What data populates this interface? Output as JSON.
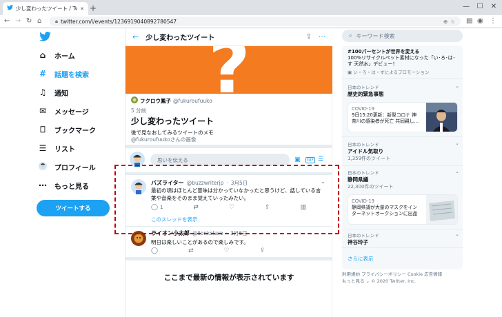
{
  "browser": {
    "tab_title": "少し変わったツイート / Twitter",
    "url": "twitter.com/i/events/1236919040892780547",
    "new_tab": "+",
    "window": {
      "min": "—",
      "max": "☐",
      "close": "✕"
    }
  },
  "nav": {
    "items": [
      {
        "label": "ホーム",
        "icon": "home-icon"
      },
      {
        "label": "話題を検索",
        "icon": "hashtag-icon"
      },
      {
        "label": "通知",
        "icon": "bell-icon"
      },
      {
        "label": "メッセージ",
        "icon": "mail-icon"
      },
      {
        "label": "ブックマーク",
        "icon": "bookmark-icon"
      },
      {
        "label": "リスト",
        "icon": "list-icon"
      },
      {
        "label": "プロフィール",
        "icon": "avatar-icon"
      },
      {
        "label": "もっと見る",
        "icon": "more-icon"
      }
    ],
    "tweet_button": "ツイートする"
  },
  "main": {
    "header_title": "少し変わったツイート",
    "moment": {
      "author_name": "フクロウ鳳子",
      "author_handle": "@fukuroufuuko",
      "time": "5 分前",
      "title": "少し変わったツイート",
      "description": "後で見なおしてみるツイートのメモ",
      "credit": "@fukuroufuukoさんの画像"
    },
    "compose_placeholder": "思いを伝える",
    "tweets": [
      {
        "name": "バズライター",
        "handle": "@buzzwriterjp",
        "date": "3月5日",
        "text_line1": "最初の頃はほとんど意味は分かっていなかったと思うけど、話している言",
        "text_line2": "葉や音楽をそのまま覚えていったみたい。",
        "reply_count": "1",
        "thread_link": "このスレッドを表示"
      },
      {
        "name": "ライオン小太郎",
        "handle": "@lionkotaro",
        "date": "3月6日",
        "text": "明日は楽しいことがあるので楽しみです。"
      }
    ],
    "end_message": "ここまで最新の情報が表示されています"
  },
  "right": {
    "search_placeholder": "キーワード検索",
    "promo": {
      "title": "#100パーセントが世界を変える",
      "text": "100%リサイクルペット素材になった「い･ろ･は･す 天然水」デビュー！",
      "by": "い・ろ・は・すによるプロモーション"
    },
    "trends": [
      {
        "category": "日本のトレンド",
        "name": "歴史的緊急事態",
        "count": ""
      },
      {
        "category": "日本のトレンド",
        "name": "アイドル気取り",
        "count": "1,359件のツイート"
      },
      {
        "category": "日本のトレンド",
        "name": "静岡県議",
        "count": "22,300件のツイート"
      },
      {
        "category": "日本のトレンド",
        "name": "神谷玲子",
        "count": ""
      }
    ],
    "cards": [
      {
        "tag": "COVID-19",
        "text": "9日15:20更新：新型コロナ 神奈川の感染者が死亡 共同親し…"
      },
      {
        "tag": "COVID-19",
        "text": "静岡県議が大量のマスクをインターネットオークションに出品"
      }
    ],
    "show_more": "さらに表示",
    "footer_line1": "利用規約 プライバシーポリシー Cookie 広告情報",
    "footer_line2": "もっと見る ⌄ © 2020 Twitter, Inc."
  },
  "colors": {
    "brand": "#1da1f2",
    "banner": "#f47b20",
    "highlight_border": "#c00000"
  }
}
